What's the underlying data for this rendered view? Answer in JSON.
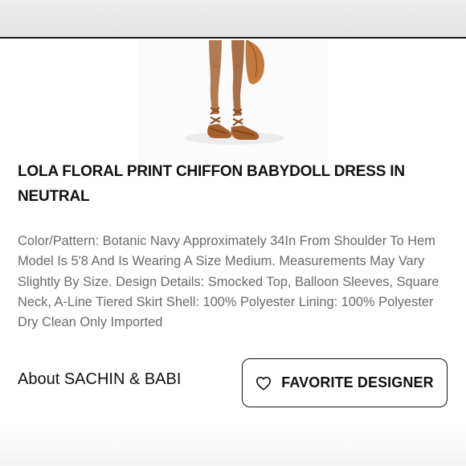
{
  "product": {
    "title": "LOLA FLORAL PRINT CHIFFON BABYDOLL DRESS IN NEUTRAL",
    "description": "Color/Pattern: Botanic Navy Approximately 34In From Shoulder To Hem Model Is 5'8 And Is Wearing A Size Medium. Measurements May Vary Slightly By Size. Design Details: Smocked Top, Balloon Sleeves, Square Neck, A-Line Tiered Skirt Shell: 100% Polyester Lining: 100% Polyester Dry Clean Only Imported"
  },
  "designer": {
    "about_label": "About SACHIN & BABI",
    "favorite_label": "FAVORITE DESIGNER",
    "favorite_icon": "heart-outline-icon"
  },
  "colors": {
    "text_primary": "#111111",
    "text_secondary": "#6b6b6b",
    "border": "#111111",
    "skin": "#b07a52",
    "sandal": "#a5602f",
    "bag": "#c47a3e"
  }
}
